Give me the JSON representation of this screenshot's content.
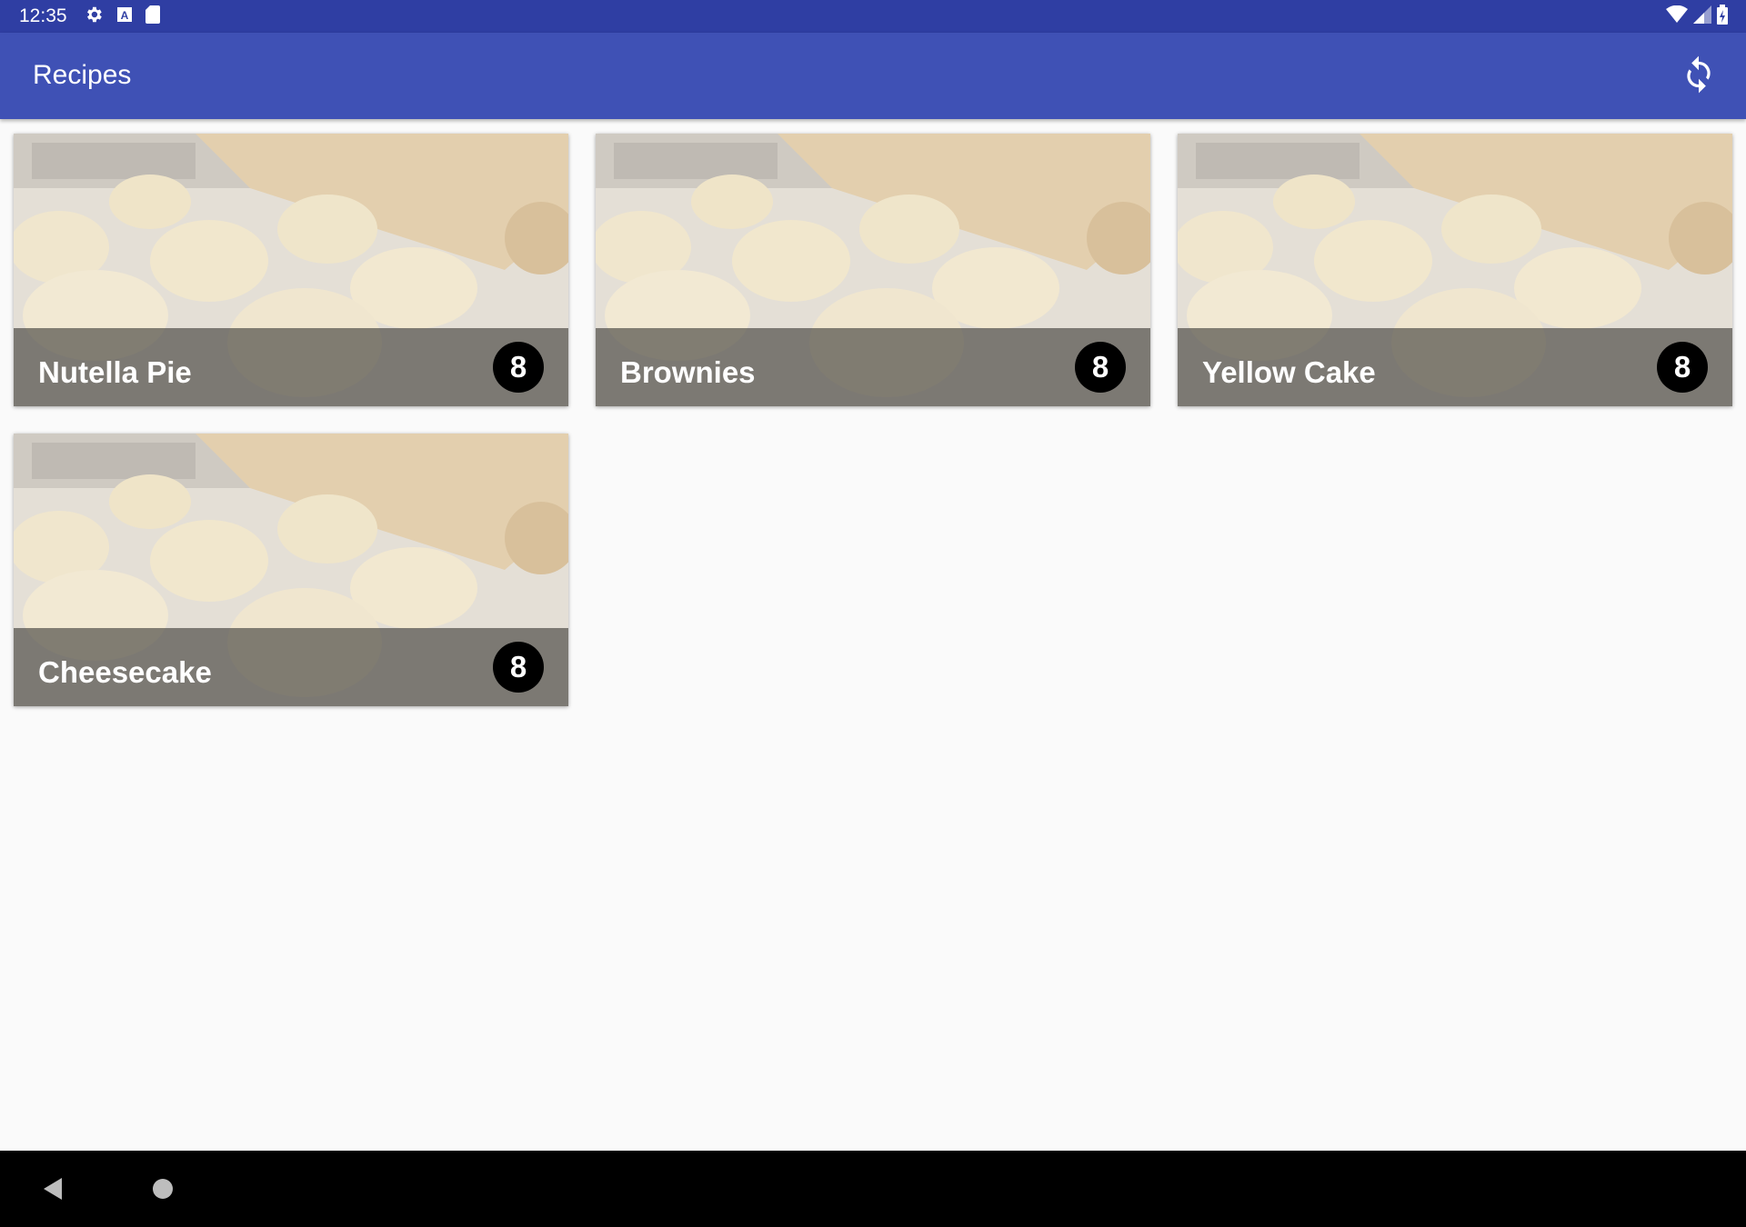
{
  "status_bar": {
    "time": "12:35",
    "left_icons": [
      "gear-icon",
      "keyboard-a-icon",
      "sd-card-icon"
    ],
    "right_icons": [
      "wifi-icon",
      "signal-icon",
      "battery-icon"
    ]
  },
  "app_bar": {
    "title": "Recipes",
    "action_icon": "refresh-icon"
  },
  "recipes": [
    {
      "name": "Nutella Pie",
      "servings": "8"
    },
    {
      "name": "Brownies",
      "servings": "8"
    },
    {
      "name": "Yellow Cake",
      "servings": "8"
    },
    {
      "name": "Cheesecake",
      "servings": "8"
    }
  ],
  "nav_bar": {
    "icons": [
      "back-icon",
      "home-icon"
    ]
  },
  "colors": {
    "status_bar": "#2f3ea3",
    "app_bar": "#3f51b5",
    "background": "#fafafa",
    "badge": "#000000"
  }
}
